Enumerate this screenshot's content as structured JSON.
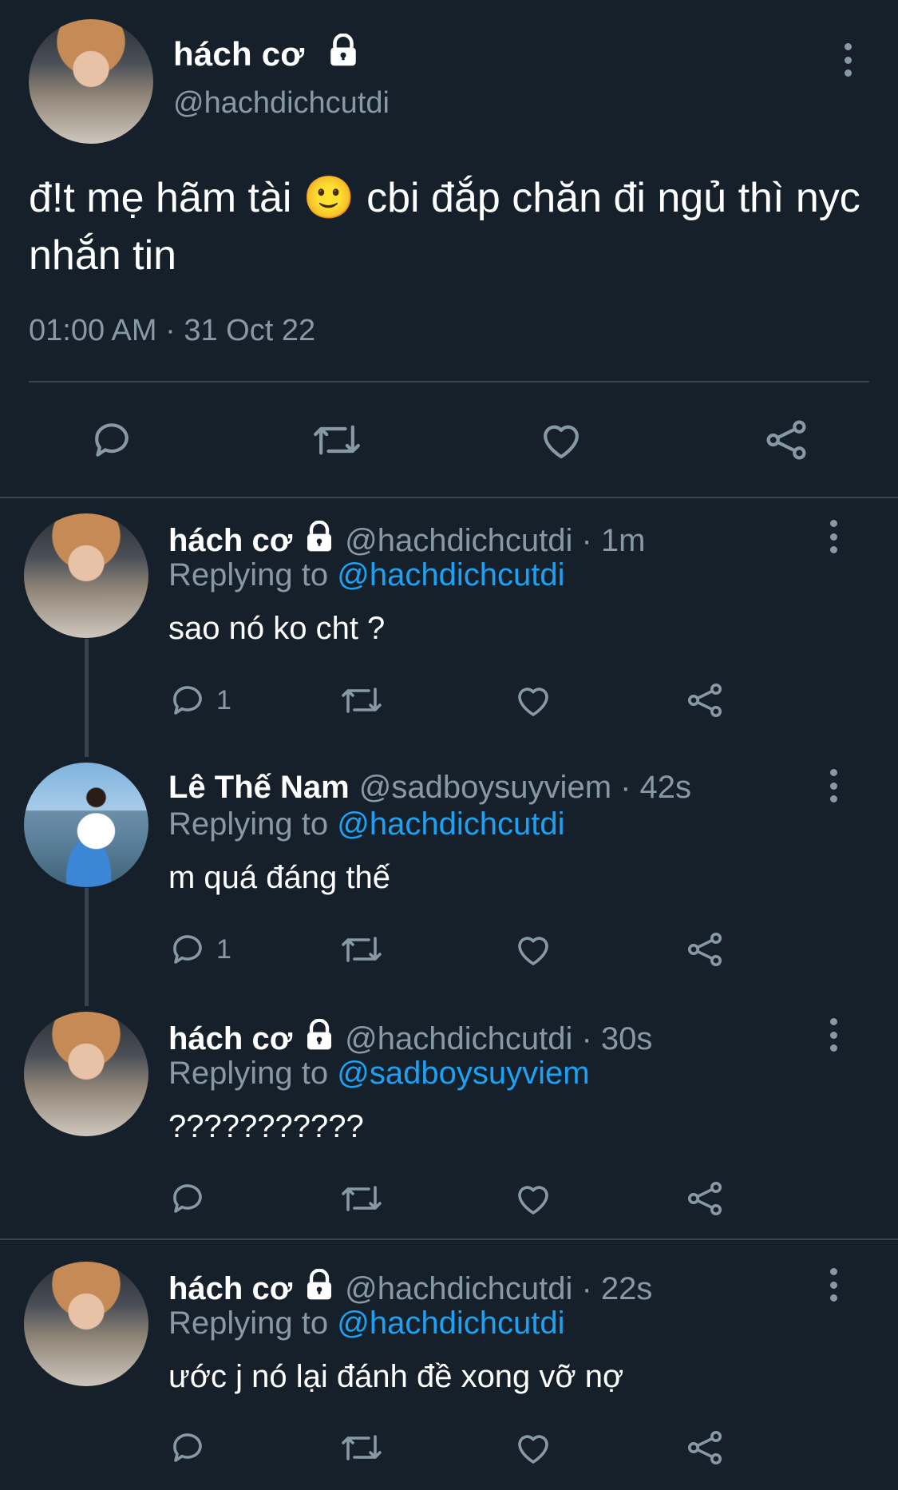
{
  "main_tweet": {
    "name": "hách cơ",
    "handle": "@hachdichcutdi",
    "text": "đ!t mẹ hãm tài 🙂 cbi đắp chăn đi ngủ thì nyc nhắn tin",
    "timestamp": "01:00 AM · 31 Oct 22"
  },
  "replies": [
    {
      "name": "hách cơ",
      "handle": "@hachdichcutdi · 1m",
      "replying_prefix": "Replying to ",
      "replying_to": "@hachdichcutdi",
      "text": "sao nó ko cht ?",
      "reply_count": "1",
      "locked": true
    },
    {
      "name": "Lê Thế Nam",
      "handle": "@sadboysuyviem · 42s",
      "replying_prefix": "Replying to ",
      "replying_to": "@hachdichcutdi",
      "text": "m quá đáng thế",
      "reply_count": "1",
      "locked": false
    },
    {
      "name": "hách cơ",
      "handle": "@hachdichcutdi · 30s",
      "replying_prefix": "Replying to ",
      "replying_to": "@sadboysuyviem",
      "text": "???????????",
      "reply_count": "",
      "locked": true
    },
    {
      "name": "hách cơ",
      "handle": "@hachdichcutdi · 22s",
      "replying_prefix": "Replying to ",
      "replying_to": "@hachdichcutdi",
      "text": "ước j nó lại đánh đề xong vỡ nợ",
      "reply_count": "",
      "locked": true
    }
  ],
  "colors": {
    "background": "#15202b",
    "secondary_text": "#8899a6",
    "link": "#1da1f2",
    "divider": "#38444d"
  },
  "icons": [
    "avatar",
    "lock-icon",
    "more-options-icon",
    "reply-icon",
    "retweet-icon",
    "like-icon",
    "share-icon"
  ]
}
